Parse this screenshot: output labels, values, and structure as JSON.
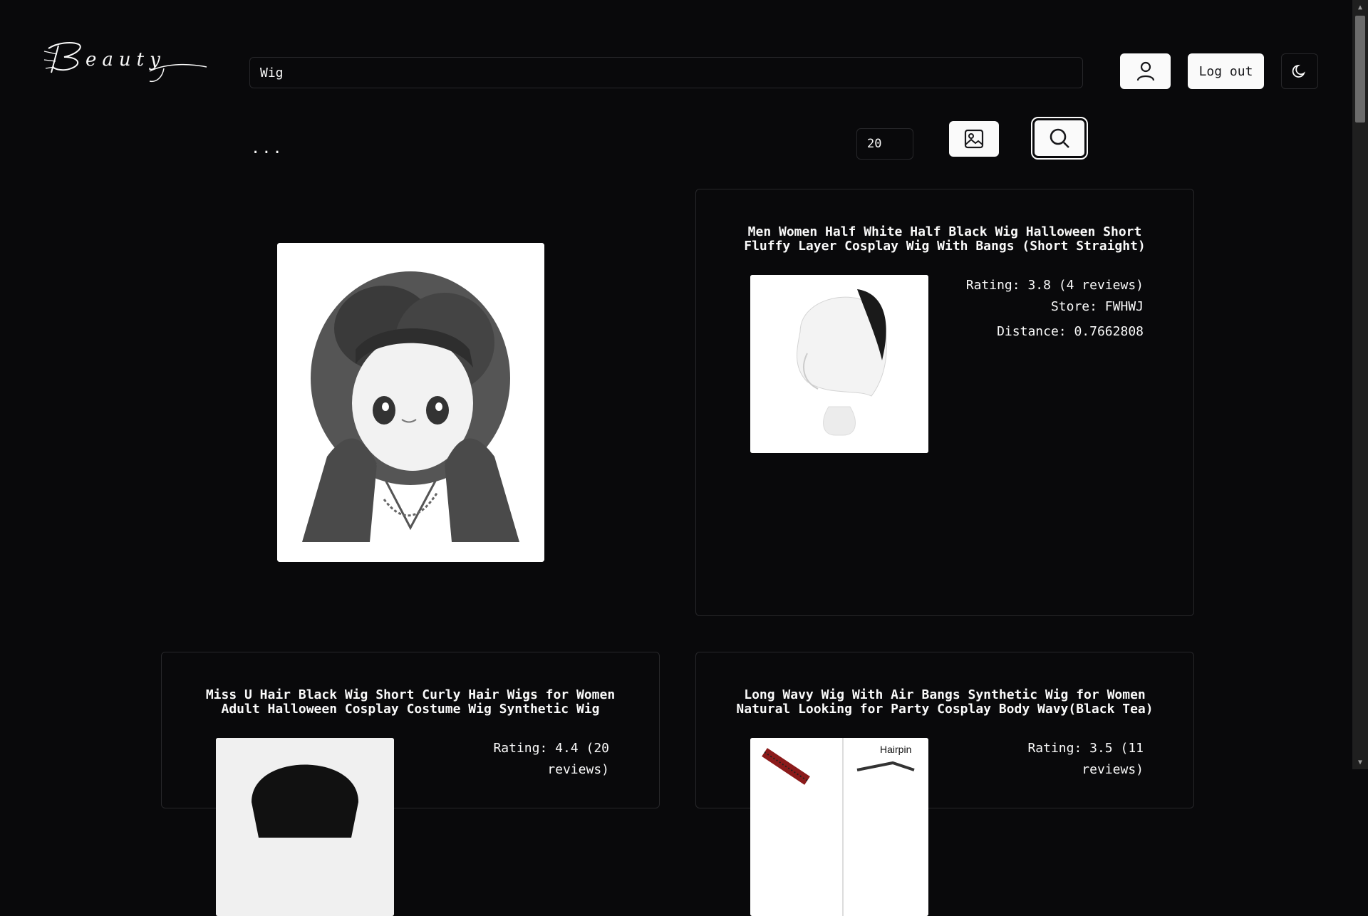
{
  "header": {
    "logo_text": "Beauty",
    "search_value": "Wig",
    "logout_label": "Log out",
    "icons": {
      "user": "user-icon",
      "theme": "moon-icon"
    }
  },
  "toolbar": {
    "more_label": "...",
    "result_count": "20",
    "icons": {
      "image_upload": "image-icon",
      "search": "search-icon"
    }
  },
  "query_image": {
    "description_icon": "uploaded-image"
  },
  "results": [
    {
      "title": "Men Women Half White Half Black Wig Halloween Short Fluffy Layer Cosplay Wig With Bangs (Short Straight)",
      "rating": "Rating: 3.8 (4 reviews)",
      "store": "Store: FWHWJ",
      "distance": "Distance: 0.7662808"
    },
    {
      "title": "Miss U Hair Black Wig Short Curly Hair Wigs for Women Adult Halloween Cosplay Costume Wig Synthetic Wig",
      "rating": "Rating: 4.4 (20 reviews)"
    },
    {
      "title": "Long Wavy Wig With Air Bangs Synthetic Wig for Women Natural Looking for Party Cosplay Body Wavy(Black Tea)",
      "rating": "Rating: 3.5 (11 reviews)",
      "thumb_label": "Hairpin"
    }
  ],
  "colors": {
    "background": "#09090b",
    "border": "#27272a",
    "button": "#fafafa"
  }
}
